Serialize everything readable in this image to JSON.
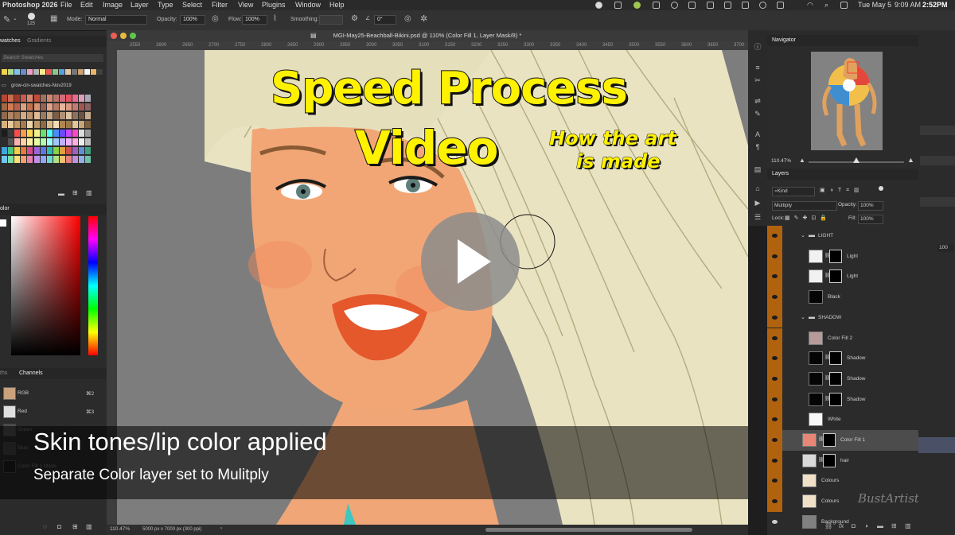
{
  "menubar": {
    "app": "Photoshop 2026",
    "items": [
      "File",
      "Edit",
      "Image",
      "Layer",
      "Type",
      "Select",
      "Filter",
      "View",
      "Plugins",
      "Window",
      "Help"
    ],
    "date": "Tue May 5",
    "time": "9:09 AM",
    "clock_overlay": "2:52PM"
  },
  "options": {
    "brush_size": "125",
    "mode_label": "Mode:",
    "mode_value": "Normal",
    "opacity_label": "Opacity:",
    "opacity_value": "100%",
    "flow_label": "Flow:",
    "flow_value": "100%",
    "smoothing_label": "Smoothing:",
    "angle_value": "0°"
  },
  "left": {
    "swatches_tab": "watches",
    "gradients_tab": "Gradients",
    "search_placeholder": "Search Swatches",
    "folder_name": "grow-cin-swatches-Nov2019",
    "color_tab": "olor",
    "paths_tab": "ths",
    "channels_tab": "Channels",
    "channels": [
      {
        "name": "RGB",
        "shortcut": "⌘2"
      },
      {
        "name": "Red",
        "shortcut": "⌘3"
      },
      {
        "name": "Green",
        "shortcut": ""
      },
      {
        "name": "Blue",
        "shortcut": ""
      },
      {
        "name": "Color Fill 1 Mask",
        "shortcut": ""
      }
    ]
  },
  "document": {
    "title": "MGI-May25-Beachball-Bikini.psd @ 110% (Color Fill 1, Layer Mask/8) *",
    "ruler_ticks": [
      "2550",
      "2600",
      "2650",
      "2700",
      "2750",
      "2800",
      "2850",
      "2900",
      "2950",
      "3000",
      "3050",
      "3100",
      "3150",
      "3200",
      "3250",
      "3300",
      "3350",
      "3400",
      "3450",
      "3500",
      "3550",
      "3600",
      "3650",
      "3700"
    ],
    "zoom": "110.47%",
    "doc_size": "5000 px x 7000 px (300 ppi)"
  },
  "overlay": {
    "title_line1": "Speed Process",
    "title_line2": "Video",
    "sub_line1": "How the art",
    "sub_line2": "is made",
    "caption_main": "Skin tones/lip color applied",
    "caption_sub": "Separate Color layer set to Mulitply",
    "watermark": "BustArtist"
  },
  "navigator": {
    "tab": "Navigator",
    "zoom": "110.47%"
  },
  "layers": {
    "tab": "Layers",
    "filter_kind": "Kind",
    "blend_mode": "Multiply",
    "opacity_label": "Opacity:",
    "opacity_value": "100%",
    "lock_label": "Lock:",
    "fill_label": "Fill:",
    "fill_value": "100%",
    "rows": [
      {
        "name": "LIGHT",
        "type": "group"
      },
      {
        "name": "Light",
        "type": "layer"
      },
      {
        "name": "Light",
        "type": "layer"
      },
      {
        "name": "Black",
        "type": "layer"
      },
      {
        "name": "SHADOW",
        "type": "group"
      },
      {
        "name": "Color Fill 2",
        "type": "layer"
      },
      {
        "name": "Shadow",
        "type": "layer"
      },
      {
        "name": "Shadow",
        "type": "layer"
      },
      {
        "name": "Shadow",
        "type": "layer"
      },
      {
        "name": "White",
        "type": "layer"
      },
      {
        "name": "Color Fill 1",
        "type": "layer",
        "selected": true
      },
      {
        "name": "hair",
        "type": "layer"
      },
      {
        "name": "Colours",
        "type": "layer"
      },
      {
        "name": "Colours",
        "type": "layer"
      },
      {
        "name": "Background",
        "type": "layer"
      }
    ]
  },
  "farright": {
    "value": "100"
  },
  "colors": {
    "accent_yellow": "#fff200",
    "layer_visibility": "#b0620e",
    "hair": "#e9e3c2",
    "skin": "#f2a676",
    "lips": "#e5582c"
  }
}
